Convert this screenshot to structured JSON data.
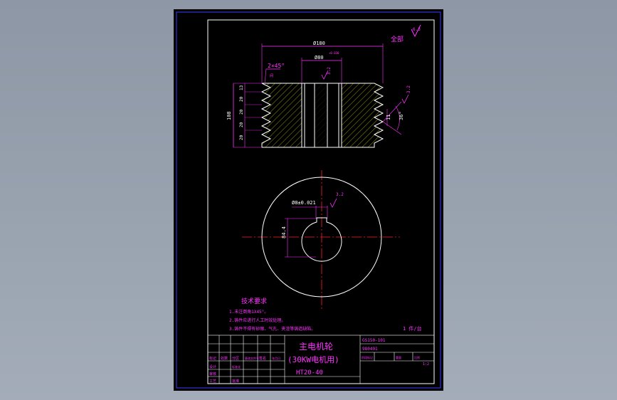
{
  "drawing": {
    "title_cn": "主电机轮",
    "subtitle_cn": "(30KW电机用)",
    "material": "HT20-40",
    "roughness_all_label": "全部",
    "roughness_all_value": "6.3",
    "roughness_keyway_value": "3.2",
    "roughness_groove_value": "3.2",
    "quantity_note": "1 件/台",
    "drawing_code": "GS150-101",
    "drawing_code_2": "980491",
    "scale": "1:2"
  },
  "dimensions": {
    "outer_diameter": "Ø180",
    "bore_diameter": "Ø80",
    "bore_tolerance": "+0.030",
    "chamfer": "2×45°",
    "groove_angle": "36°",
    "groove_depth": "11",
    "height_total": "108",
    "pitch_1": "13",
    "pitch_2": "20",
    "pitch_3": "20",
    "pitch_4": "20",
    "pitch_5": "20",
    "keyway_width": "Ø8±0.021",
    "keyway_depth": "84.4"
  },
  "requirements": {
    "title": "技术要求",
    "items": [
      "1.未注倒角1X45°。",
      "2.铸件应进行人工时效处理。",
      "3.铸件不得有砂眼、气孔、夹渣等铸造缺陷。"
    ]
  },
  "title_block": {
    "row_labels": [
      "标记",
      "处数",
      "分区",
      "更改文件号",
      "签名",
      "年月日"
    ],
    "row_labels_2": [
      "设计",
      "标准化",
      "审核",
      "工艺",
      "批准"
    ],
    "stage_labels": [
      "阶段标记",
      "重量",
      "比例"
    ]
  },
  "colors": {
    "dimension": "#ff33ff",
    "outline": "#ffffff",
    "hatch": "#ffff00",
    "center": "#ff2020",
    "frame": "#3b3bff"
  }
}
